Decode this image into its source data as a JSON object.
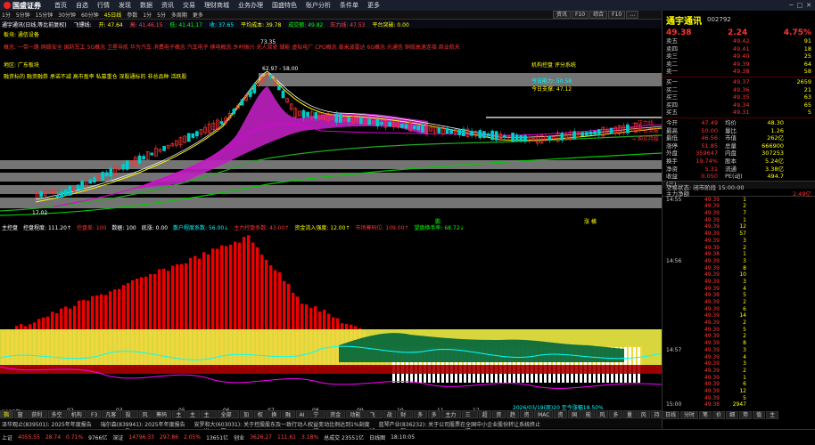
{
  "menu": {
    "logo": "国盛证券",
    "items": [
      "首页",
      "自选",
      "行情",
      "发现",
      "数据",
      "资讯",
      "交易",
      "理财商城",
      "业务办理",
      "国盛特色",
      "账户分析",
      "条件单",
      "更多"
    ]
  },
  "toolbar": {
    "items": [
      "1分",
      "5分钟",
      "15分钟",
      "30分钟",
      "60分钟",
      "45日线",
      "参数",
      "1分",
      "5分",
      "多周期",
      "更多"
    ],
    "active": 5
  },
  "right_tabs": [
    "资讯",
    "F10",
    "综合",
    "F10",
    "…"
  ],
  "stock_header": {
    "name": "通宇通讯(日线,等比前复权)",
    "items": [
      {
        "t": "飞镖线:",
        "c": "s1"
      },
      {
        "t": "开: 47.64",
        "c": "y"
      },
      {
        "t": "高: 41.46.15",
        "c": "r"
      },
      {
        "t": "低: 41.41.17",
        "c": "g"
      },
      {
        "t": "收: 37.65",
        "c": "c"
      },
      {
        "t": "平均成本: 39.78",
        "c": "y"
      },
      {
        "t": "成交额: 49.82",
        "c": "g"
      },
      {
        "t": "压力线: 47.53",
        "c": "r"
      },
      {
        "t": "平台突破: 0.00",
        "c": "y"
      }
    ]
  },
  "chart_annotations": [
    {
      "t": "板块: 通信设备",
      "c": "#ff0"
    },
    {
      "t": "概念: 一带一路 网络安全 国防军工 5G概念 卫星导航 华为汽车 消费电子概念 汽车电子 换电概念 乡村振兴 无人驾驶 储能 虚拟电厂 CPO概念 毫米波雷达 6G概念 光通信 铜缆高速连接 商业航天",
      "c": "#f33"
    },
    {
      "t": "地区: 广东板块",
      "c": "#ff0"
    },
    {
      "t": "融资标的 融资融券 承诺不减 高市盈率 私募重仓 深股通标的 非总品种 活跃股",
      "c": "#ff0"
    },
    {
      "t": "机构控盘 评分系统",
      "c": "#ff0"
    },
    {
      "t": "今日能力: 50.58",
      "c": "#0ff"
    },
    {
      "t": "今日支撑: 47.12",
      "c": "#ff0"
    },
    {
      "t": "73.35",
      "c": "#fff"
    },
    {
      "t": "62.97 - 58.00",
      "c": "#fff"
    },
    {
      "t": "17.02",
      "c": "#fff"
    },
    {
      "t": "→ 压力线",
      "c": "#f33"
    },
    {
      "t": "→ 平台突破",
      "c": "#f33"
    },
    {
      "t": "→ 购买持股",
      "c": "#f33"
    }
  ],
  "indicator_header": {
    "name": "主控盘",
    "items": [
      {
        "t": "控盘程度: 111.20↑",
        "c": "#fff"
      },
      {
        "t": "控盘差: 100",
        "c": "#f33"
      },
      {
        "t": "数据: 100",
        "c": "#fff"
      },
      {
        "t": "底涨: 0.00",
        "c": "#fff"
      },
      {
        "t": "散户程度系数: 56.00↓",
        "c": "#0ff"
      },
      {
        "t": "主力控盘系数: 43.00↑",
        "c": "#f33"
      },
      {
        "t": "资金流入强度: 12.00↑",
        "c": "#ff0"
      },
      {
        "t": "市场筹码位: 109.00↑",
        "c": "#f33"
      },
      {
        "t": "望盘换手率: 68.72↓",
        "c": "#0f0"
      }
    ],
    "markers": [
      "鹏",
      "涨 横"
    ]
  },
  "time_axis": [
    "2025年",
    "02",
    "03",
    "05",
    "06",
    "07",
    "08",
    "09",
    "10",
    "11",
    "12",
    "2026年"
  ],
  "time_info": "2026/03/19(周)20 至今涨幅18.50%",
  "bottom_tabs": [
    "指标",
    "窗口",
    "获利分析",
    "多空分析",
    "机构持仓",
    "F3社",
    "凡客权限",
    "投资乐",
    "风险",
    "筹码分布",
    "主买",
    "主卖",
    "主买出",
    "全部全景图",
    "加仓",
    "权益",
    "换手",
    "融资",
    "AI选",
    "宁波银",
    "资金流向",
    "动能二号",
    "飞镖线",
    "战神",
    "财神到",
    "多空",
    "多空",
    "主力量能",
    "三元聚",
    "超扫",
    "资金",
    "趋势",
    "资金",
    "MAC",
    "资金",
    "国信",
    "能量",
    "风",
    "多空",
    "量化",
    "风",
    "持股",
    "预警"
  ],
  "news": [
    "泽华观止(839501): 2025年年度报告",
    "瑞尔森(839941): 2025年年度报告",
    "安罗和大(603031): 关于控股股东及一致行动人权益变动比例达到1%刻度",
    "蓝琴产业(836232): 关于公司股票在全国中小企业股份转让系统终止"
  ],
  "status": [
    {
      "t": "上证",
      "c": "w"
    },
    {
      "t": "4055.55",
      "c": "r"
    },
    {
      "t": "28.74",
      "c": "r"
    },
    {
      "t": "0.71%",
      "c": "r"
    },
    {
      "t": "9766亿",
      "c": "w"
    },
    {
      "t": "深证",
      "c": "w"
    },
    {
      "t": "14796.33",
      "c": "r"
    },
    {
      "t": "297.86",
      "c": "r"
    },
    {
      "t": "2.05%",
      "c": "r"
    },
    {
      "t": "13651亿",
      "c": "w"
    },
    {
      "t": "创业",
      "c": "w"
    },
    {
      "t": "3626.27",
      "c": "r"
    },
    {
      "t": "111.61",
      "c": "r"
    },
    {
      "t": "3.18%",
      "c": "r"
    },
    {
      "t": "总成交 23551亿",
      "c": "w"
    },
    {
      "t": "日线图",
      "c": "w"
    },
    {
      "t": "18:10:05",
      "c": "w"
    }
  ],
  "right_panel": {
    "name": "通宇通讯",
    "code": "002792",
    "last": "49.38",
    "change": "2.24",
    "pct": "4.75%",
    "sells": [
      {
        "l": "卖五",
        "p": "49.42",
        "v": "91"
      },
      {
        "l": "卖四",
        "p": "49.41",
        "v": "18"
      },
      {
        "l": "卖三",
        "p": "49.40",
        "v": "25"
      },
      {
        "l": "卖二",
        "p": "49.39",
        "v": "64"
      },
      {
        "l": "卖一",
        "p": "49.38",
        "v": "58"
      }
    ],
    "buys": [
      {
        "l": "买一",
        "p": "49.37",
        "v": "2659"
      },
      {
        "l": "买二",
        "p": "49.36",
        "v": "21"
      },
      {
        "l": "买三",
        "p": "49.35",
        "v": "63"
      },
      {
        "l": "买四",
        "p": "49.34",
        "v": "65"
      },
      {
        "l": "买五",
        "p": "49.31",
        "v": "5"
      }
    ],
    "stats": [
      {
        "k": "今开",
        "v": "47.49",
        "k2": "均价",
        "v2": "48.30"
      },
      {
        "k": "最高",
        "v": "50.00",
        "k2": "量比",
        "v2": "1.26"
      },
      {
        "k": "最低",
        "v": "46.56",
        "k2": "市值",
        "v2": "262亿"
      },
      {
        "k": "涨停",
        "v": "51.85",
        "k2": "总量",
        "v2": "666900"
      },
      {
        "k": "外盘",
        "v": "359647",
        "k2": "内盘",
        "v2": "307253"
      },
      {
        "k": "换手",
        "v": "19.74%",
        "k2": "股本",
        "v2": "5.24亿"
      },
      {
        "k": "净资",
        "v": "5.31",
        "k2": "流通",
        "v2": "3.38亿"
      },
      {
        "k": "收益(三)",
        "v": "0.050",
        "k2": "PE(动)",
        "v2": "494.7"
      }
    ],
    "trade_status": "交易状态: 闭市阶段 15:00:00",
    "flow_label": "主力净额",
    "flow_value": "2.49亿",
    "ticks": [
      {
        "t": "14:55",
        "p": "49.39",
        "v": "1",
        "x": ""
      },
      {
        "t": "",
        "p": "49.39",
        "v": "2",
        "x": ""
      },
      {
        "t": "",
        "p": "49.39",
        "v": "7",
        "x": ""
      },
      {
        "t": "",
        "p": "49.39",
        "v": "1",
        "x": ""
      },
      {
        "t": "",
        "p": "49.39",
        "v": "12",
        "x": ""
      },
      {
        "t": "",
        "p": "49.39",
        "v": "57",
        "x": ""
      },
      {
        "t": "",
        "p": "49.39",
        "v": "3",
        "x": ""
      },
      {
        "t": "",
        "p": "49.39",
        "v": "2",
        "x": ""
      },
      {
        "t": "",
        "p": "49.38",
        "v": "1",
        "x": ""
      },
      {
        "t": "14:56",
        "p": "49.39",
        "v": "3",
        "x": ""
      },
      {
        "t": "",
        "p": "49.39",
        "v": "8",
        "x": ""
      },
      {
        "t": "",
        "p": "49.39",
        "v": "10",
        "x": ""
      },
      {
        "t": "",
        "p": "49.39",
        "v": "3",
        "x": ""
      },
      {
        "t": "",
        "p": "49.39",
        "v": "4",
        "x": ""
      },
      {
        "t": "",
        "p": "49.38",
        "v": "5",
        "x": ""
      },
      {
        "t": "",
        "p": "49.39",
        "v": "2",
        "x": ""
      },
      {
        "t": "",
        "p": "49.39",
        "v": "6",
        "x": ""
      },
      {
        "t": "",
        "p": "49.39",
        "v": "14",
        "x": ""
      },
      {
        "t": "",
        "p": "49.39",
        "v": "2",
        "x": ""
      },
      {
        "t": "",
        "p": "49.39",
        "v": "5",
        "x": ""
      },
      {
        "t": "",
        "p": "49.39",
        "v": "2",
        "x": ""
      },
      {
        "t": "",
        "p": "49.39",
        "v": "8",
        "x": ""
      },
      {
        "t": "14:57",
        "p": "49.39",
        "v": "3",
        "x": ""
      },
      {
        "t": "",
        "p": "49.39",
        "v": "4",
        "x": ""
      },
      {
        "t": "",
        "p": "49.39",
        "v": "3",
        "x": ""
      },
      {
        "t": "",
        "p": "49.39",
        "v": "2",
        "x": ""
      },
      {
        "t": "",
        "p": "49.39",
        "v": "1",
        "x": ""
      },
      {
        "t": "",
        "p": "49.39",
        "v": "6",
        "x": ""
      },
      {
        "t": "",
        "p": "49.39",
        "v": "12",
        "x": ""
      },
      {
        "t": "",
        "p": "49.39",
        "v": "5",
        "x": ""
      },
      {
        "t": "15:00",
        "p": "49.38",
        "v": "2947",
        "x": ""
      }
    ],
    "bottom_tabs": [
      "日线",
      "分时",
      "笔",
      "价",
      "细",
      "势",
      "值",
      "主"
    ]
  }
}
